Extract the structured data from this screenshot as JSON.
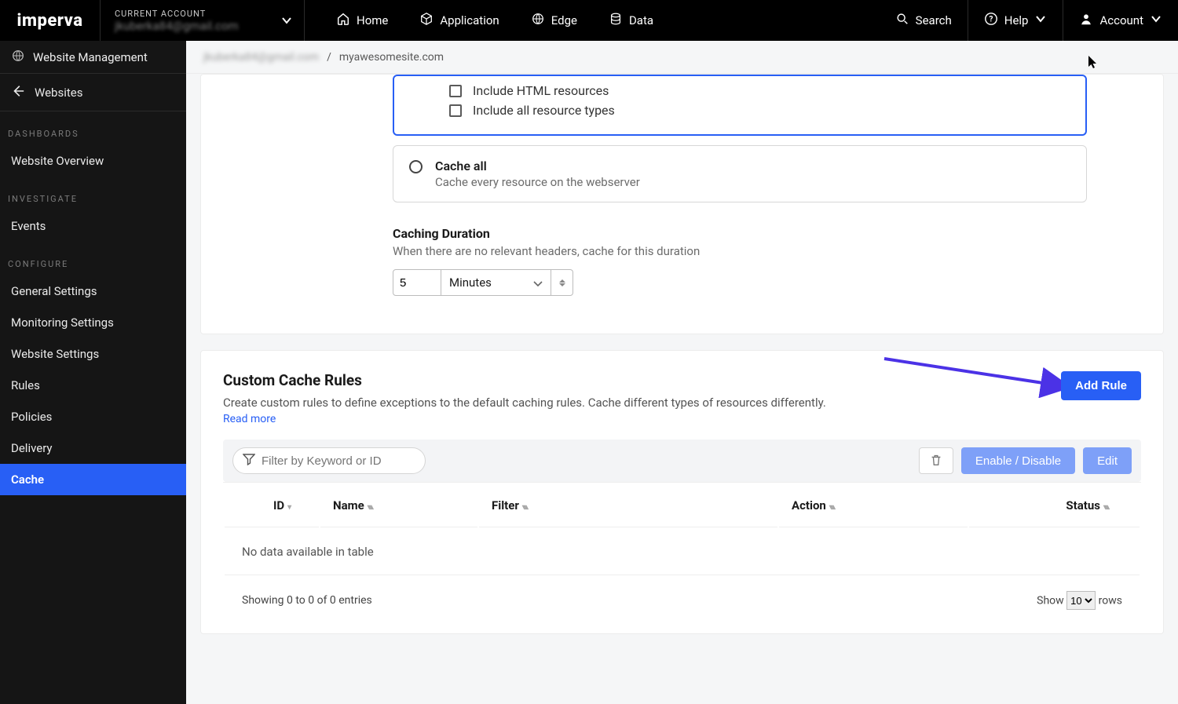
{
  "brand": "imperva",
  "account_label": "CURRENT ACCOUNT",
  "account_value": "jkuberka84@gmail.com",
  "nav": {
    "home": "Home",
    "application": "Application",
    "edge": "Edge",
    "data": "Data",
    "search": "Search",
    "help": "Help",
    "account": "Account"
  },
  "sidebar": {
    "top": "Website Management",
    "back": "Websites",
    "sections": {
      "dashboards": "DASHBOARDS",
      "investigate": "INVESTIGATE",
      "configure": "CONFIGURE"
    },
    "items": {
      "overview": "Website Overview",
      "events": "Events",
      "general": "General Settings",
      "monitoring": "Monitoring Settings",
      "website_settings": "Website Settings",
      "rules": "Rules",
      "policies": "Policies",
      "delivery": "Delivery",
      "cache": "Cache"
    }
  },
  "breadcrumb": {
    "account": "jkuberka84@gmail.com",
    "site": "myawesomesite.com"
  },
  "cache_panel": {
    "include_html": "Include HTML resources",
    "include_all": "Include all resource types",
    "cache_all_title": "Cache all",
    "cache_all_sub": "Cache every resource on the webserver",
    "duration_title": "Caching Duration",
    "duration_desc": "When there are no relevant headers, cache for this duration",
    "duration_value": "5",
    "duration_unit": "Minutes"
  },
  "rules_panel": {
    "title": "Custom Cache Rules",
    "desc": "Create custom rules to define exceptions to the default caching rules. Cache different types of resources differently.",
    "read_more": "Read more",
    "add_rule": "Add Rule",
    "filter_placeholder": "Filter by Keyword or ID",
    "enable_disable": "Enable / Disable",
    "edit": "Edit",
    "cols": {
      "id": "ID",
      "name": "Name",
      "filter": "Filter",
      "action": "Action",
      "status": "Status"
    },
    "no_data": "No data available in table",
    "showing": "Showing 0 to 0 of 0 entries",
    "show": "Show",
    "rows": "rows",
    "page_size": "10"
  }
}
